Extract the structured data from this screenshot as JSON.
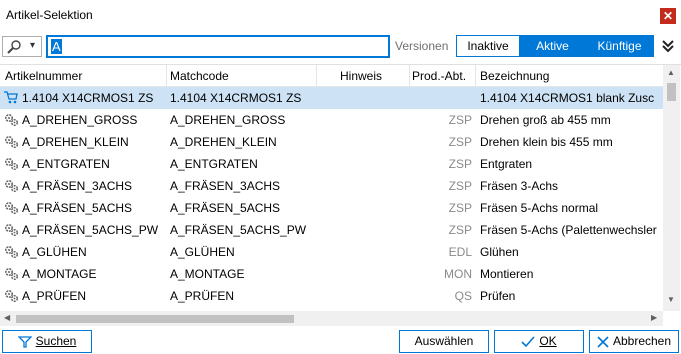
{
  "window": {
    "title": "Artikel-Selektion",
    "close_glyph": "✕"
  },
  "toolbar": {
    "search_value": "A",
    "versionen_label": "Versionen",
    "segments": [
      "Inaktive",
      "Aktive",
      "Künftige"
    ]
  },
  "grid": {
    "columns": [
      "Artikelnummer",
      "Matchcode",
      "Hinweis",
      "Prod.-Abt.",
      "Bezeichnung"
    ],
    "rows": [
      {
        "icon": "cart-icon",
        "artikelnummer": "1.4104 X14CRMOS1 ZS",
        "matchcode": "1.4104 X14CRMOS1 ZS",
        "hinweis": "",
        "abt": "",
        "bezeichnung": "1.4104 X14CRMOS1 blank Zusc",
        "selected": true
      },
      {
        "icon": "gears-icon",
        "artikelnummer": "A_DREHEN_GROSS",
        "matchcode": "A_DREHEN_GROSS",
        "hinweis": "",
        "abt": "ZSP",
        "bezeichnung": "Drehen groß ab 455 mm"
      },
      {
        "icon": "gears-icon",
        "artikelnummer": "A_DREHEN_KLEIN",
        "matchcode": "A_DREHEN_KLEIN",
        "hinweis": "",
        "abt": "ZSP",
        "bezeichnung": "Drehen klein bis 455 mm"
      },
      {
        "icon": "gears-icon",
        "artikelnummer": "A_ENTGRATEN",
        "matchcode": "A_ENTGRATEN",
        "hinweis": "",
        "abt": "ZSP",
        "bezeichnung": "Entgraten"
      },
      {
        "icon": "gears-icon",
        "artikelnummer": "A_FRÄSEN_3ACHS",
        "matchcode": "A_FRÄSEN_3ACHS",
        "hinweis": "",
        "abt": "ZSP",
        "bezeichnung": "Fräsen 3-Achs"
      },
      {
        "icon": "gears-icon",
        "artikelnummer": "A_FRÄSEN_5ACHS",
        "matchcode": "A_FRÄSEN_5ACHS",
        "hinweis": "",
        "abt": "ZSP",
        "bezeichnung": "Fräsen 5-Achs normal"
      },
      {
        "icon": "gears-icon",
        "artikelnummer": "A_FRÄSEN_5ACHS_PW",
        "matchcode": "A_FRÄSEN_5ACHS_PW",
        "hinweis": "",
        "abt": "ZSP",
        "bezeichnung": "Fräsen 5-Achs (Palettenwechsler"
      },
      {
        "icon": "gears-icon",
        "artikelnummer": "A_GLÜHEN",
        "matchcode": "A_GLÜHEN",
        "hinweis": "",
        "abt": "EDL",
        "bezeichnung": "Glühen"
      },
      {
        "icon": "gears-icon",
        "artikelnummer": "A_MONTAGE",
        "matchcode": "A_MONTAGE",
        "hinweis": "",
        "abt": "MON",
        "bezeichnung": "Montieren"
      },
      {
        "icon": "gears-icon",
        "artikelnummer": "A_PRÜFEN",
        "matchcode": "A_PRÜFEN",
        "hinweis": "",
        "abt": "QS",
        "bezeichnung": "Prüfen"
      }
    ]
  },
  "buttons": {
    "suchen": "Suchen",
    "auswaehlen": "Auswählen",
    "ok": "OK",
    "abbrechen": "Abbrechen"
  },
  "colors": {
    "accent": "#0078d7",
    "selected_row": "#cde2f4",
    "close": "#c42b1c"
  }
}
